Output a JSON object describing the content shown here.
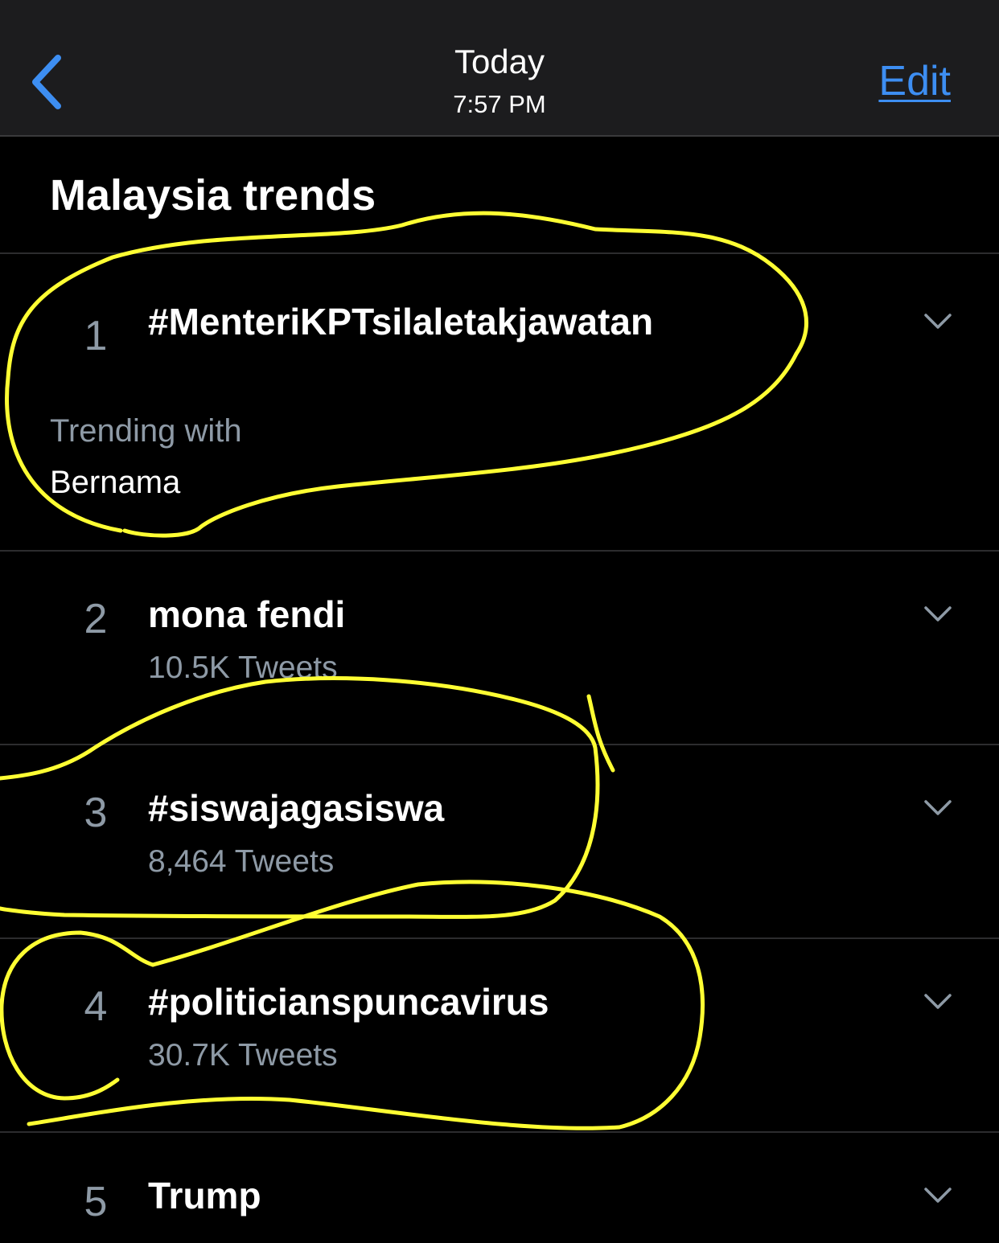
{
  "navbar": {
    "back_icon": "chevron-left-icon",
    "title": "Today",
    "subtitle": "7:57 PM",
    "edit_label": "Edit",
    "accent_color": "#3d8ef2"
  },
  "section": {
    "title": "Malaysia trends"
  },
  "trends": [
    {
      "rank": "1",
      "name": "#MenteriKPTsilaletakjawatan",
      "context_label": "Trending with",
      "context_value": "Bernama"
    },
    {
      "rank": "2",
      "name": "mona fendi",
      "meta": "10.5K Tweets"
    },
    {
      "rank": "3",
      "name": "#siswajagasiswa",
      "meta": "8,464 Tweets"
    },
    {
      "rank": "4",
      "name": "#politicianspuncavirus",
      "meta": "30.7K Tweets"
    },
    {
      "rank": "5",
      "name": "Trump"
    }
  ],
  "row_icon": "chevron-down-icon",
  "annotation_color": "#ffff33"
}
